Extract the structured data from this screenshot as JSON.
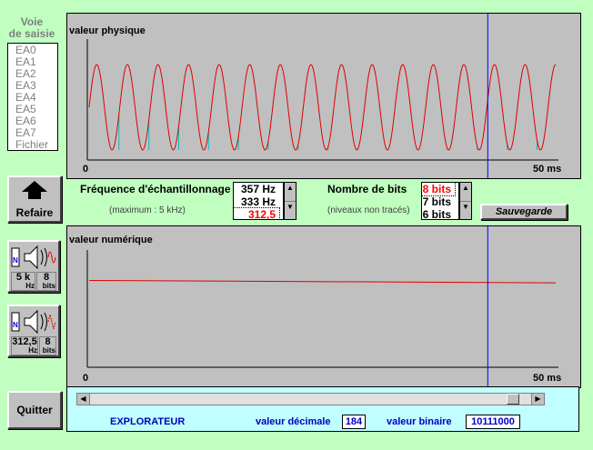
{
  "voie": {
    "title_line1": "Voie",
    "title_line2": "de saisie",
    "items": [
      "EA0",
      "EA1",
      "EA2",
      "EA3",
      "EA4",
      "EA5",
      "EA6",
      "EA7",
      "Fichier"
    ]
  },
  "top_graph": {
    "title": "valeur physique",
    "x_start": "0",
    "x_end": "50 ms",
    "cursor_ms": 42.5
  },
  "controls": {
    "freq_label": "Fréquence d'échantillonnage",
    "freq_max": "(maximum :  5 kHz)",
    "freq_options": [
      "357 Hz",
      "333 Hz",
      "312,5 Hz"
    ],
    "freq_selected": "312,5 Hz",
    "bits_label": "Nombre de bits",
    "bits_note": "(niveaux non tracés)",
    "bits_options": [
      "8 bits",
      "7 bits",
      "6 bits"
    ],
    "bits_selected": "8 bits",
    "save_label": "Sauvegarde",
    "refaire_label": "Refaire"
  },
  "presets": [
    {
      "rate": "5 k",
      "rate_unit": "Hz",
      "bits": "8",
      "bits_unit": "bits"
    },
    {
      "rate": "312,5",
      "rate_unit": "Hz",
      "bits": "8",
      "bits_unit": "bits"
    }
  ],
  "bottom_graph": {
    "title": "valeur numérique",
    "x_start": "0",
    "x_end": "50 ms"
  },
  "explorer": {
    "label": "EXPLORATEUR",
    "decimal_label": "valeur décimale",
    "decimal_value": "184",
    "binary_label": "valeur binaire",
    "binary_value": "10111000",
    "scroll_fraction": 0.97
  },
  "quit_label": "Quitter",
  "colors": {
    "signal": "#e00000",
    "samples": "#00c0c0",
    "cursor": "#0000ff",
    "explorer_text": "#0000c0",
    "selected": "#ff0000"
  },
  "chart_data": [
    {
      "type": "line",
      "title": "valeur physique",
      "xlim": [
        0,
        50
      ],
      "x_unit": "ms",
      "series": [
        {
          "values_desc": "sine",
          "frequency_hz": 305,
          "amplitude": 1
        }
      ],
      "samples_period_ms": 3.2
    },
    {
      "type": "line",
      "title": "valeur numérique",
      "xlim": [
        0,
        50
      ],
      "x_unit": "ms",
      "series": [
        {
          "x": [
            0,
            50
          ],
          "y": [
            0.74,
            0.72
          ]
        }
      ]
    }
  ]
}
